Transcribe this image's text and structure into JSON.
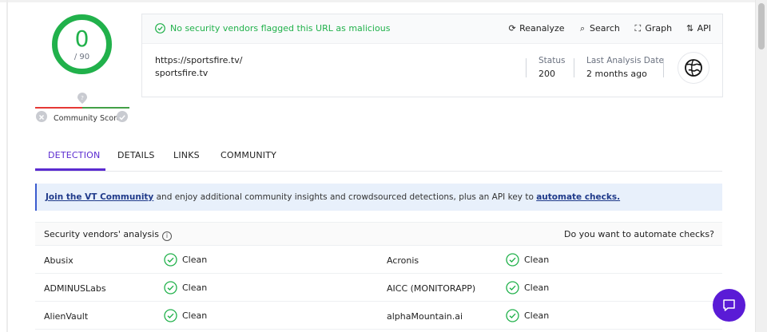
{
  "score": {
    "value": "0",
    "total": "/ 90",
    "color": "#21b14b"
  },
  "community": {
    "label": "Community Score"
  },
  "header": {
    "verdict": "No security vendors flagged this URL as malicious",
    "actions": [
      {
        "label": "Reanalyze",
        "icon": "reanalyze-icon"
      },
      {
        "label": "Search",
        "icon": "search-icon"
      },
      {
        "label": "Graph",
        "icon": "graph-icon"
      },
      {
        "label": "API",
        "icon": "api-icon"
      }
    ],
    "url": "https://sportsfire.tv/",
    "domain": "sportsfire.tv",
    "status_label": "Status",
    "status_value": "200",
    "last_analysis_label": "Last Analysis Date",
    "last_analysis_value": "2 months ago"
  },
  "tabs": [
    "DETECTION",
    "DETAILS",
    "LINKS",
    "COMMUNITY"
  ],
  "active_tab": "DETECTION",
  "banner": {
    "link1": "Join the VT Community",
    "text": " and enjoy additional community insights and crowdsourced detections, plus an API key to ",
    "link2": "automate checks."
  },
  "analysis": {
    "title": "Security vendors' analysis",
    "right": "Do you want to automate checks?",
    "rows": [
      {
        "left_vendor": "Abusix",
        "left_result": "Clean",
        "right_vendor": "Acronis",
        "right_result": "Clean"
      },
      {
        "left_vendor": "ADMINUSLabs",
        "left_result": "Clean",
        "right_vendor": "AICC (MONITORAPP)",
        "right_result": "Clean"
      },
      {
        "left_vendor": "AlienVault",
        "left_result": "Clean",
        "right_vendor": "alphaMountain.ai",
        "right_result": "Clean"
      }
    ]
  },
  "colors": {
    "accent": "#5b2bd0",
    "clean": "#21b14b",
    "chat": "#5a1bd6"
  }
}
